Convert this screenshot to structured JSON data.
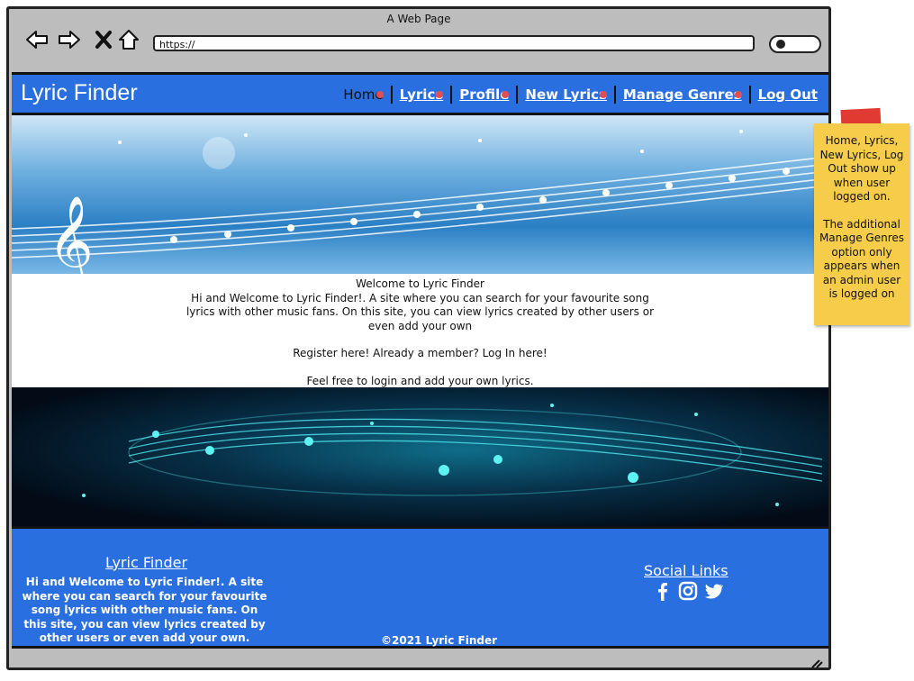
{
  "window": {
    "title": "A Web Page",
    "url": "https://"
  },
  "header": {
    "brand": "Lyric Finder",
    "menu": [
      "Home",
      "Lyrics",
      "Profile",
      "New Lyrics",
      "Manage Genres",
      "Log Out"
    ]
  },
  "welcome": {
    "title": "Welcome to Lyric Finder",
    "intro": "Hi and Welcome to Lyric Finder!. A site where you can search for your favourite song lyrics with other music fans. On this site, you can view lyrics created by other users or even add your own",
    "register": "Register here! Already a member? Log In here!",
    "cta": "Feel free to login and add your own lyrics."
  },
  "footer": {
    "title": "Lyric Finder",
    "text": "Hi and Welcome to Lyric Finder!. A site where you can search for your favourite song lyrics with other music fans. On this site, you can view lyrics created by other users or even add your own.",
    "social_title": "Social Links",
    "copyright": "©2021 Lyric Finder"
  },
  "note": {
    "line1": "Home, Lyrics, New Lyrics, Log Out show up when user logged on.",
    "line2": "The additional Manage Genres option only appears when an admin user is logged on"
  },
  "icons": [
    "back-arrow-icon",
    "forward-arrow-icon",
    "close-icon",
    "home-icon",
    "search-icon",
    "facebook-icon",
    "instagram-icon",
    "twitter-icon"
  ],
  "colors": {
    "brand_blue": "#2a6fe0",
    "note_yellow": "#f6cd4a",
    "tape_red": "#e03a33"
  }
}
